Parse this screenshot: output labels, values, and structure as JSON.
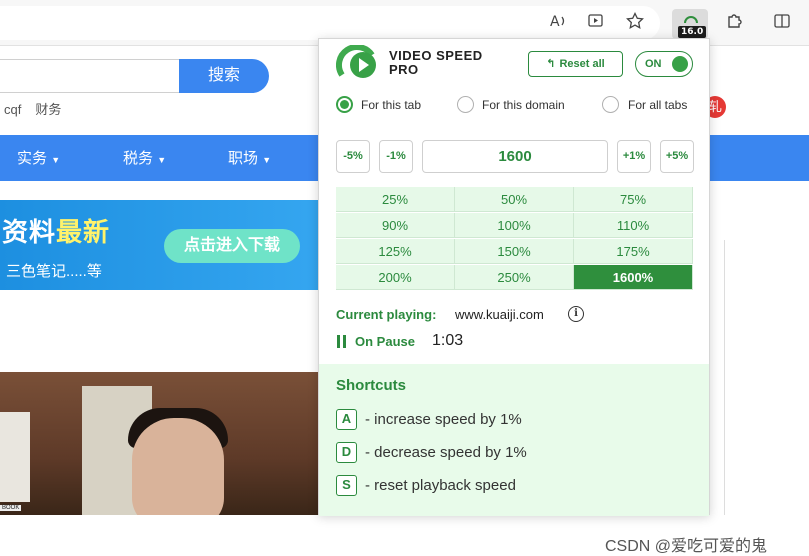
{
  "browser": {
    "icons": [
      "read-aloud-icon",
      "immersive-reader-icon",
      "favorite-star-icon",
      "extensions-icon",
      "split-screen-icon"
    ],
    "extension_badge": "16.0"
  },
  "background_page": {
    "search_button": "搜索",
    "hot_words": [
      "cqf",
      "财务"
    ],
    "nav_items": [
      "实务",
      "税务",
      "职场"
    ],
    "banner_title_part1": "资料",
    "banner_title_part2": "最新",
    "banner_subtitle": "三色笔记.....等",
    "banner_cta": "点击进入下载",
    "book_label": "BOOK",
    "red_badge": "轧",
    "watermark": "CSDN @爱吃可爱的鬼"
  },
  "popup": {
    "brand_line1": "VIDEO SPEED",
    "brand_line2": "PRO",
    "reset_all": "Reset all",
    "toggle_label": "ON",
    "toggle_on": true,
    "scope_options": [
      {
        "label": "For this tab",
        "selected": true
      },
      {
        "label": "For this domain",
        "selected": false
      },
      {
        "label": "For all tabs",
        "selected": false
      }
    ],
    "steps": {
      "minus5": "-5%",
      "minus1": "-1%",
      "plus1": "+1%",
      "plus5": "+5%"
    },
    "speed_value": "1600",
    "presets": [
      "25%",
      "50%",
      "75%",
      "90%",
      "100%",
      "110%",
      "125%",
      "150%",
      "175%",
      "200%",
      "250%",
      "1600%"
    ],
    "active_preset": "1600%",
    "current_playing_label": "Current playing:",
    "current_site": "www.kuaiji.com",
    "status_label": "On Pause",
    "time": "1:03",
    "shortcuts_title": "Shortcuts",
    "shortcuts": [
      {
        "key": "A",
        "text": "- increase speed by 1%"
      },
      {
        "key": "D",
        "text": "- decrease speed by 1%"
      },
      {
        "key": "S",
        "text": "- reset playback speed"
      }
    ],
    "accent_color": "#2b8a3e"
  }
}
